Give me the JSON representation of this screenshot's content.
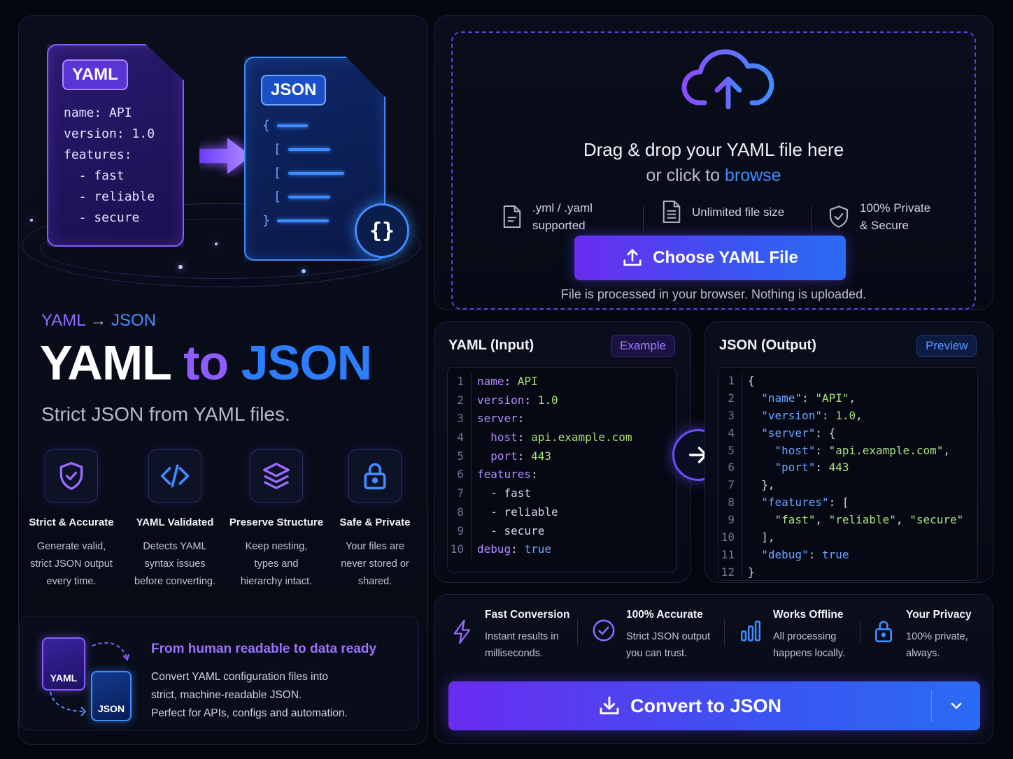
{
  "hero": {
    "yaml_tag": "YAML",
    "yaml_lines": [
      "name: API",
      "version: 1.0",
      "features:",
      "  - fast",
      "  - reliable",
      "  - secure"
    ],
    "json_tag": "JSON",
    "json_brace_open": "{",
    "json_brace_close": "}",
    "badge_glyph": "{}"
  },
  "eyebrow": {
    "from": "YAML",
    "arrow": "→",
    "to": "JSON"
  },
  "title": {
    "part1": "YAML",
    "part2": "to",
    "part3": "JSON"
  },
  "subtitle": "Strict JSON from YAML files.",
  "features": [
    {
      "icon": "shield-check-icon",
      "title": "Strict & Accurate",
      "desc": [
        "Generate valid,",
        "strict JSON output",
        "every time."
      ]
    },
    {
      "icon": "code-icon",
      "title": "YAML Validated",
      "desc": [
        "Detects YAML",
        "syntax issues",
        "before converting."
      ]
    },
    {
      "icon": "layers-icon",
      "title": "Preserve Structure",
      "desc": [
        "Keep nesting,",
        "types and",
        "hierarchy intact."
      ]
    },
    {
      "icon": "lock-icon",
      "title": "Safe & Private",
      "desc": [
        "Your files are",
        "never stored or",
        "shared."
      ]
    }
  ],
  "promo": {
    "yaml_label": "YAML",
    "json_label": "JSON",
    "title": "From human readable to data ready",
    "lines": [
      "Convert YAML configuration files into",
      "strict, machine-readable JSON.",
      "Perfect for APIs, configs and automation."
    ]
  },
  "upload": {
    "title": "Drag & drop your YAML file here",
    "sub_prefix": "or click to",
    "sub_link": "browse",
    "info": [
      {
        "icon": "file-icon",
        "lines": [
          ".yml / .yaml",
          "supported"
        ]
      },
      {
        "icon": "file-text-icon",
        "lines": [
          "Unlimited file size"
        ]
      },
      {
        "icon": "shield-check-icon",
        "lines": [
          "100% Private",
          "& Secure"
        ]
      }
    ],
    "button_label": "Choose YAML File",
    "note": "File is processed in your browser. Nothing is uploaded."
  },
  "yaml_panel": {
    "title": "YAML (Input)",
    "badge": "Example",
    "lines": [
      [
        [
          "ky",
          "name"
        ],
        [
          "pn",
          ": "
        ],
        [
          "vs",
          "API"
        ]
      ],
      [
        [
          "ky",
          "version"
        ],
        [
          "pn",
          ": "
        ],
        [
          "vn",
          "1.0"
        ]
      ],
      [
        [
          "ky",
          "server"
        ],
        [
          "pn",
          ":"
        ]
      ],
      [
        [
          "pn",
          "  "
        ],
        [
          "ky",
          "host"
        ],
        [
          "pn",
          ": "
        ],
        [
          "vs",
          "api.example.com"
        ]
      ],
      [
        [
          "pn",
          "  "
        ],
        [
          "ky",
          "port"
        ],
        [
          "pn",
          ": "
        ],
        [
          "vn",
          "443"
        ]
      ],
      [
        [
          "ky",
          "features"
        ],
        [
          "pn",
          ":"
        ]
      ],
      [
        [
          "pn",
          "  - fast"
        ]
      ],
      [
        [
          "pn",
          "  - reliable"
        ]
      ],
      [
        [
          "pn",
          "  - secure"
        ]
      ],
      [
        [
          "ky",
          "debug"
        ],
        [
          "pn",
          ": "
        ],
        [
          "vb",
          "true"
        ]
      ]
    ]
  },
  "json_panel": {
    "title": "JSON (Output)",
    "badge": "Preview",
    "lines": [
      [
        [
          "pn",
          "{"
        ]
      ],
      [
        [
          "pn",
          "  "
        ],
        [
          "jk",
          "\"name\""
        ],
        [
          "pn",
          ": "
        ],
        [
          "vs",
          "\"API\""
        ],
        [
          "pn",
          ","
        ]
      ],
      [
        [
          "pn",
          "  "
        ],
        [
          "jk",
          "\"version\""
        ],
        [
          "pn",
          ": "
        ],
        [
          "vn",
          "1.0"
        ],
        [
          "pn",
          ","
        ]
      ],
      [
        [
          "pn",
          "  "
        ],
        [
          "jk",
          "\"server\""
        ],
        [
          "pn",
          ": {"
        ]
      ],
      [
        [
          "pn",
          "    "
        ],
        [
          "jk",
          "\"host\""
        ],
        [
          "pn",
          ": "
        ],
        [
          "vs",
          "\"api.example.com\""
        ],
        [
          "pn",
          ","
        ]
      ],
      [
        [
          "pn",
          "    "
        ],
        [
          "jk",
          "\"port\""
        ],
        [
          "pn",
          ": "
        ],
        [
          "vn",
          "443"
        ]
      ],
      [
        [
          "pn",
          "  },"
        ]
      ],
      [
        [
          "pn",
          "  "
        ],
        [
          "jk",
          "\"features\""
        ],
        [
          "pn",
          ": ["
        ]
      ],
      [
        [
          "pn",
          "    "
        ],
        [
          "vs",
          "\"fast\""
        ],
        [
          "pn",
          ", "
        ],
        [
          "vs",
          "\"reliable\""
        ],
        [
          "pn",
          ", "
        ],
        [
          "vs",
          "\"secure\""
        ]
      ],
      [
        [
          "pn",
          "  ],"
        ]
      ],
      [
        [
          "pn",
          "  "
        ],
        [
          "jk",
          "\"debug\""
        ],
        [
          "pn",
          ": "
        ],
        [
          "vb",
          "true"
        ]
      ],
      [
        [
          "pn",
          "}"
        ]
      ]
    ]
  },
  "perks": [
    {
      "icon": "bolt-icon",
      "title": "Fast Conversion",
      "desc": [
        "Instant results in",
        "milliseconds."
      ]
    },
    {
      "icon": "check-circle-icon",
      "title": "100% Accurate",
      "desc": [
        "Strict JSON output",
        "you can trust."
      ]
    },
    {
      "icon": "bar-chart-icon",
      "title": "Works Offline",
      "desc": [
        "All processing",
        "happens locally."
      ]
    },
    {
      "icon": "lock-icon",
      "title": "Your Privacy",
      "desc": [
        "100% private,",
        "always."
      ]
    }
  ],
  "convert": {
    "label": "Convert to JSON"
  },
  "colors": {
    "purple": "#8f5cff",
    "blue": "#2d7dff",
    "bg": "#05070f"
  }
}
